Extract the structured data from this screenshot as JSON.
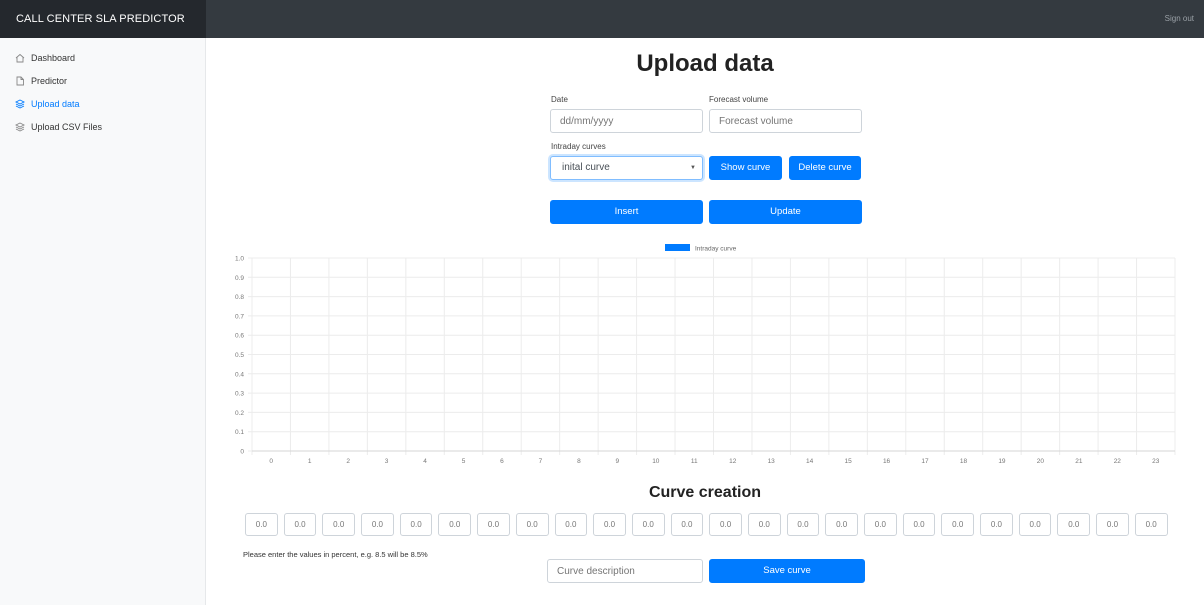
{
  "header": {
    "brand": "CALL CENTER SLA PREDICTOR",
    "signout": "Sign out"
  },
  "sidebar": {
    "items": [
      {
        "label": "Dashboard",
        "icon": "home-icon",
        "active": false
      },
      {
        "label": "Predictor",
        "icon": "file-icon",
        "active": false
      },
      {
        "label": "Upload data",
        "icon": "layers-icon",
        "active": true
      },
      {
        "label": "Upload CSV Files",
        "icon": "layers-icon",
        "active": false
      }
    ]
  },
  "main": {
    "title": "Upload data",
    "date": {
      "label": "Date",
      "placeholder": "dd/mm/yyyy"
    },
    "forecast": {
      "label": "Forecast volume",
      "placeholder": "Forecast volume"
    },
    "curves": {
      "label": "Intraday curves",
      "selected": "inital curve"
    },
    "buttons": {
      "show": "Show curve",
      "delete": "Delete curve",
      "insert": "Insert",
      "update": "Update"
    },
    "curve_creation": {
      "title": "Curve creation",
      "hint": "Please enter the values in percent, e.g. 8.5 will be 8.5%",
      "description_placeholder": "Curve description",
      "save": "Save curve"
    }
  },
  "curve_inputs": [
    "0.0",
    "0.0",
    "0.0",
    "0.0",
    "0.0",
    "0.0",
    "0.0",
    "0.0",
    "0.0",
    "0.0",
    "0.0",
    "0.0",
    "0.0",
    "0.0",
    "0.0",
    "0.0",
    "0.0",
    "0.0",
    "0.0",
    "0.0",
    "0.0",
    "0.0",
    "0.0",
    "0.0"
  ],
  "colors": {
    "accent": "#007bff",
    "topbar": "#343a40",
    "brand_bg": "#24282d",
    "sidebar_bg": "#f8f9fa"
  },
  "chart_data": {
    "type": "bar",
    "categories": [
      "0",
      "1",
      "2",
      "3",
      "4",
      "5",
      "6",
      "7",
      "8",
      "9",
      "10",
      "11",
      "12",
      "13",
      "14",
      "15",
      "16",
      "17",
      "18",
      "19",
      "20",
      "21",
      "22",
      "23"
    ],
    "series": [
      {
        "name": "Intraday curve",
        "values": []
      }
    ],
    "yticks": [
      "0",
      "0.1",
      "0.2",
      "0.3",
      "0.4",
      "0.5",
      "0.6",
      "0.7",
      "0.8",
      "0.9",
      "1.0"
    ],
    "ylim": [
      0,
      1
    ],
    "grid": true,
    "legend": "top"
  }
}
